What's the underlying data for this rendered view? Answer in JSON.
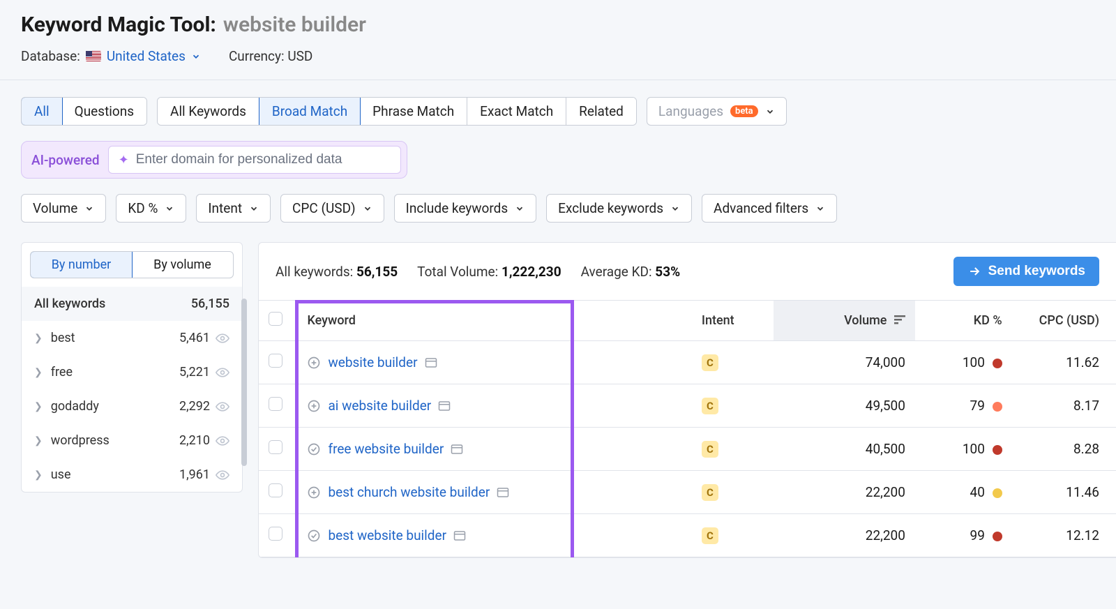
{
  "header": {
    "title": "Keyword Magic Tool:",
    "query": "website builder",
    "database_label": "Database:",
    "database_value": "United States",
    "currency_label": "Currency:",
    "currency_value": "USD"
  },
  "tabs_scope": {
    "all": "All",
    "questions": "Questions"
  },
  "tabs_match": {
    "all_keywords": "All Keywords",
    "broad": "Broad Match",
    "phrase": "Phrase Match",
    "exact": "Exact Match",
    "related": "Related"
  },
  "languages": {
    "label": "Languages",
    "badge": "beta"
  },
  "ai": {
    "label": "AI-powered",
    "placeholder": "Enter domain for personalized data"
  },
  "filters": {
    "volume": "Volume",
    "kd": "KD %",
    "intent": "Intent",
    "cpc": "CPC (USD)",
    "include": "Include keywords",
    "exclude": "Exclude keywords",
    "advanced": "Advanced filters"
  },
  "sidebar": {
    "by_number": "By number",
    "by_volume": "By volume",
    "all_keywords_label": "All keywords",
    "all_keywords_count": "56,155",
    "groups": [
      {
        "name": "best",
        "count": "5,461"
      },
      {
        "name": "free",
        "count": "5,221"
      },
      {
        "name": "godaddy",
        "count": "2,292"
      },
      {
        "name": "wordpress",
        "count": "2,210"
      },
      {
        "name": "use",
        "count": "1,961"
      }
    ]
  },
  "summary": {
    "all_keywords_label": "All keywords:",
    "all_keywords_value": "56,155",
    "total_volume_label": "Total Volume:",
    "total_volume_value": "1,222,230",
    "avg_kd_label": "Average KD:",
    "avg_kd_value": "53%",
    "send_button": "Send keywords"
  },
  "columns": {
    "keyword": "Keyword",
    "intent": "Intent",
    "volume": "Volume",
    "kd": "KD %",
    "cpc": "CPC (USD)"
  },
  "rows": [
    {
      "icon": "plus",
      "keyword": "website builder",
      "intent": "C",
      "volume": "74,000",
      "kd": "100",
      "kd_color": "#c0392b",
      "cpc": "11.62"
    },
    {
      "icon": "plus",
      "keyword": "ai website builder",
      "intent": "C",
      "volume": "49,500",
      "kd": "79",
      "kd_color": "#ff7b5c",
      "cpc": "8.17"
    },
    {
      "icon": "check",
      "keyword": "free website builder",
      "intent": "C",
      "volume": "40,500",
      "kd": "100",
      "kd_color": "#c0392b",
      "cpc": "8.28"
    },
    {
      "icon": "plus",
      "keyword": "best church website builder",
      "intent": "C",
      "volume": "22,200",
      "kd": "40",
      "kd_color": "#f2c94c",
      "cpc": "11.46"
    },
    {
      "icon": "check",
      "keyword": "best website builder",
      "intent": "C",
      "volume": "22,200",
      "kd": "99",
      "kd_color": "#c0392b",
      "cpc": "12.12"
    }
  ]
}
